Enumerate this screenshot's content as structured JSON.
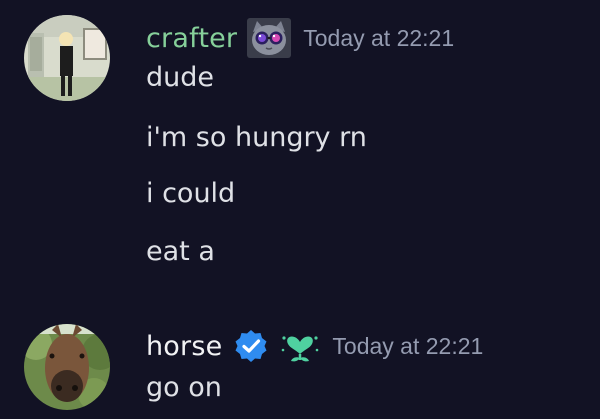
{
  "messages": [
    {
      "author": "crafter",
      "author_color": "#86d09a",
      "timestamp": "Today at 22:21",
      "badge_icon": "cat-galaxy-glasses-icon",
      "lines": [
        "dude",
        "i'm so hungry rn",
        "i could",
        "eat a"
      ]
    },
    {
      "author": "horse",
      "author_color": "#f2f3f5",
      "timestamp": "Today at 22:21",
      "badge_icons": [
        "verified-check-icon",
        "heart-sprout-icon"
      ],
      "lines": [
        "go on"
      ]
    }
  ],
  "colors": {
    "background": "#121224",
    "timestamp": "#949bb0",
    "message_text": "#dfe1e6",
    "verified_blue": "#2f8cf0",
    "sprout_green": "#4fd1a0"
  }
}
